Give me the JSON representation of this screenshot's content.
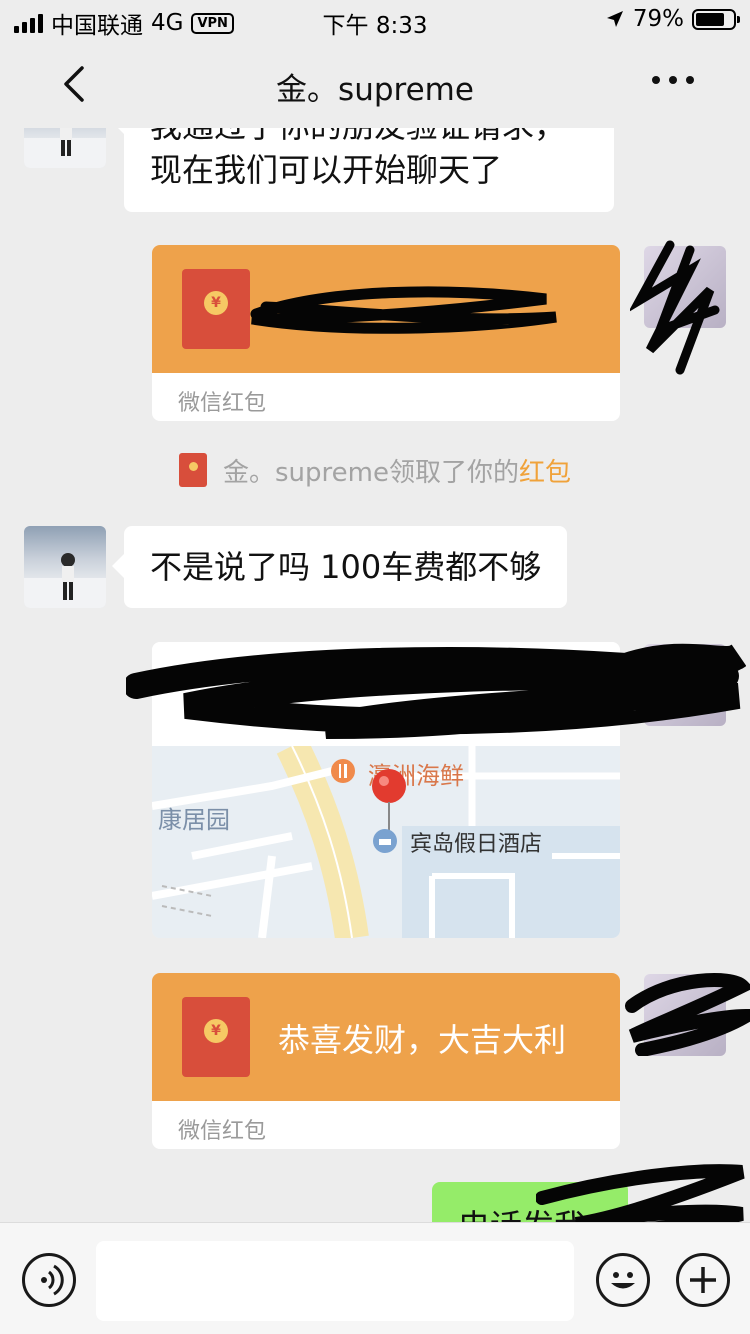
{
  "status_bar": {
    "carrier": "中国联通",
    "network": "4G",
    "vpn": "VPN",
    "time": "下午 8:33",
    "battery": "79%",
    "battery_level": 0.79
  },
  "nav": {
    "title": "金。supreme"
  },
  "messages": {
    "friend_greeting": "我通过了你的朋友验证请求，\n现在我们可以开始聊天了",
    "red_packet_1_footer": "微信红包",
    "system_prefix": "金。supreme领取了你的",
    "system_link": "红包",
    "friend_reply": "不是说了吗 100车费都不够",
    "map_labels": {
      "restaurant": "瀛洲海鲜",
      "area": "康居园",
      "hotel": "宾岛假日酒店"
    },
    "red_packet_2_text": "恭喜发财，大吉大利",
    "red_packet_2_footer": "微信红包",
    "partial_green": "电话发我"
  },
  "colors": {
    "background": "#ededed",
    "red_packet": "#eea24b",
    "sent_bubble": "#95ec69",
    "link": "#f0a23a"
  },
  "icons": {
    "back": "chevron-left-icon",
    "more": "more-dots-icon",
    "voice": "voice-icon",
    "emoji": "emoji-icon",
    "add": "plus-icon"
  }
}
